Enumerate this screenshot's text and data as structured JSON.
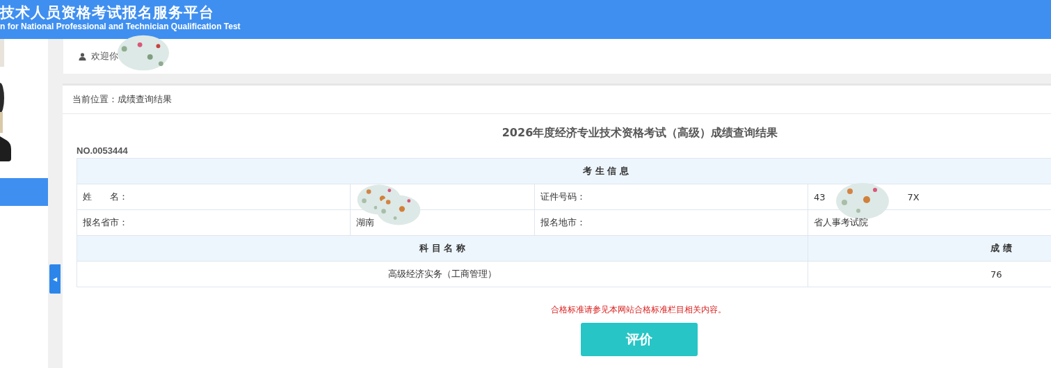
{
  "header": {
    "title": "技术人员资格考试报名服务平台",
    "subtitle": "n for National Professional and Technician Qualification Test"
  },
  "sidebar": {
    "active_item": {
      "selected": true
    },
    "collapse_button": "◀"
  },
  "welcome": {
    "text": "欢迎你"
  },
  "breadcrumb": "当前位置：成绩查询结果",
  "result_title": "2026年度经济专业技术资格考试（高级）成绩查询结果",
  "number": "NO.0053444",
  "info_table": {
    "heading": "考 生 信 息",
    "rows": [
      [
        {
          "label": "姓　　名："
        },
        {
          "redacted": true
        },
        {
          "label": "证件号码："
        },
        {
          "value": "43",
          "value_end": "7X",
          "redacted": true
        }
      ],
      [
        {
          "label": "报名省市："
        },
        {
          "value": "湖南",
          "redacted": true
        },
        {
          "label": "报名地市："
        },
        {
          "value": "省人事考试院",
          "redacted": false
        }
      ]
    ]
  },
  "score_table": {
    "columns": [
      "科 目 名 称",
      "成 绩"
    ],
    "rows": [
      [
        "高级经济实务（工商管理）",
        "76"
      ]
    ]
  },
  "note": "合格标准请参见本网站合格标准栏目相关内容。",
  "evaluate_button": "评价"
}
